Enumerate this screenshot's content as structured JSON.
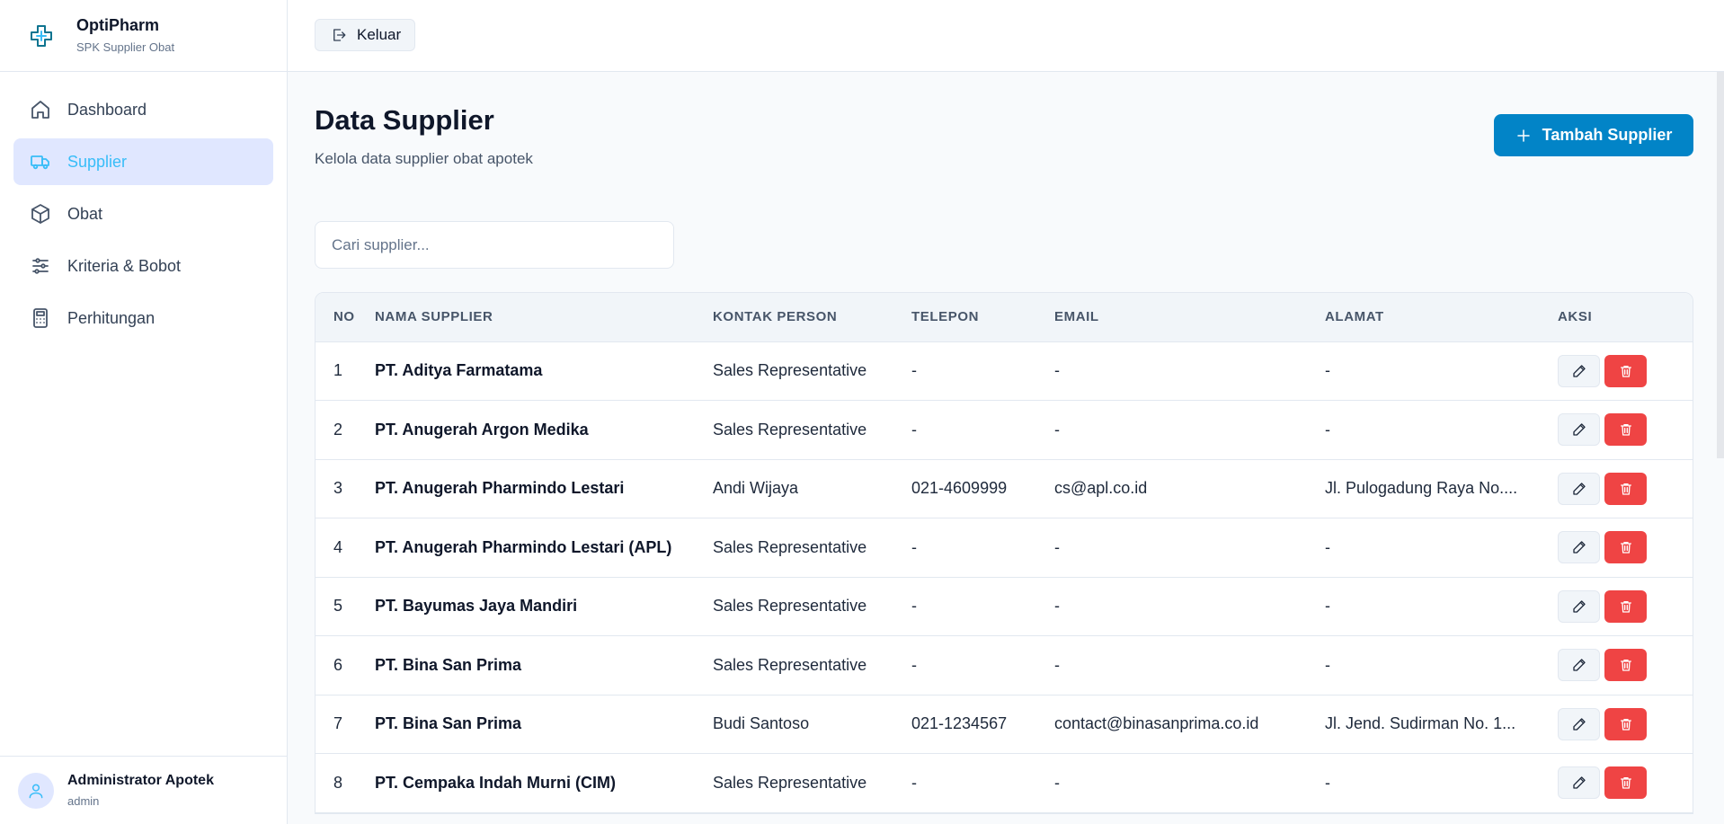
{
  "app": {
    "name": "OptiPharm",
    "subtitle": "SPK Supplier Obat",
    "logo_icon": "pharmacy-cross-icon",
    "accent_color": "#0284c7",
    "active_nav_bg": "#e0e7ff",
    "active_nav_text": "#38bdf8",
    "danger_color": "#ef4444"
  },
  "sidebar": {
    "items": [
      {
        "label": "Dashboard",
        "icon": "home-icon",
        "active": false
      },
      {
        "label": "Supplier",
        "icon": "truck-icon",
        "active": true
      },
      {
        "label": "Obat",
        "icon": "box-icon",
        "active": false
      },
      {
        "label": "Kriteria & Bobot",
        "icon": "sliders-icon",
        "active": false
      },
      {
        "label": "Perhitungan",
        "icon": "calculator-icon",
        "active": false
      }
    ]
  },
  "user": {
    "name": "Administrator Apotek",
    "role": "admin",
    "icon": "user-icon"
  },
  "topbar": {
    "logout_label": "Keluar",
    "logout_icon": "logout-icon"
  },
  "page": {
    "title": "Data Supplier",
    "subtitle": "Kelola data supplier obat apotek",
    "add_button_label": "Tambah Supplier",
    "add_button_icon": "plus-icon"
  },
  "search": {
    "placeholder": "Cari supplier...",
    "value": ""
  },
  "table": {
    "headers": [
      "NO",
      "NAMA SUPPLIER",
      "KONTAK PERSON",
      "TELEPON",
      "EMAIL",
      "ALAMAT",
      "AKSI"
    ],
    "rows": [
      {
        "no": "1",
        "name": "PT. Aditya Farmatama",
        "contact": "Sales Representative",
        "phone": "-",
        "email": "-",
        "address": "-"
      },
      {
        "no": "2",
        "name": "PT. Anugerah Argon Medika",
        "contact": "Sales Representative",
        "phone": "-",
        "email": "-",
        "address": "-"
      },
      {
        "no": "3",
        "name": "PT. Anugerah Pharmindo Lestari",
        "contact": "Andi Wijaya",
        "phone": "021-4609999",
        "email": "cs@apl.co.id",
        "address": "Jl. Pulogadung Raya No...."
      },
      {
        "no": "4",
        "name": "PT. Anugerah Pharmindo Lestari (APL)",
        "contact": "Sales Representative",
        "phone": "-",
        "email": "-",
        "address": "-"
      },
      {
        "no": "5",
        "name": "PT. Bayumas Jaya Mandiri",
        "contact": "Sales Representative",
        "phone": "-",
        "email": "-",
        "address": "-"
      },
      {
        "no": "6",
        "name": "PT. Bina San Prima",
        "contact": "Sales Representative",
        "phone": "-",
        "email": "-",
        "address": "-"
      },
      {
        "no": "7",
        "name": "PT. Bina San Prima",
        "contact": "Budi Santoso",
        "phone": "021-1234567",
        "email": "contact@binasanprima.co.id",
        "address": "Jl. Jend. Sudirman No. 1..."
      },
      {
        "no": "8",
        "name": "PT. Cempaka Indah Murni (CIM)",
        "contact": "Sales Representative",
        "phone": "-",
        "email": "-",
        "address": "-"
      }
    ],
    "edit_icon": "pencil-icon",
    "delete_icon": "trash-icon"
  }
}
